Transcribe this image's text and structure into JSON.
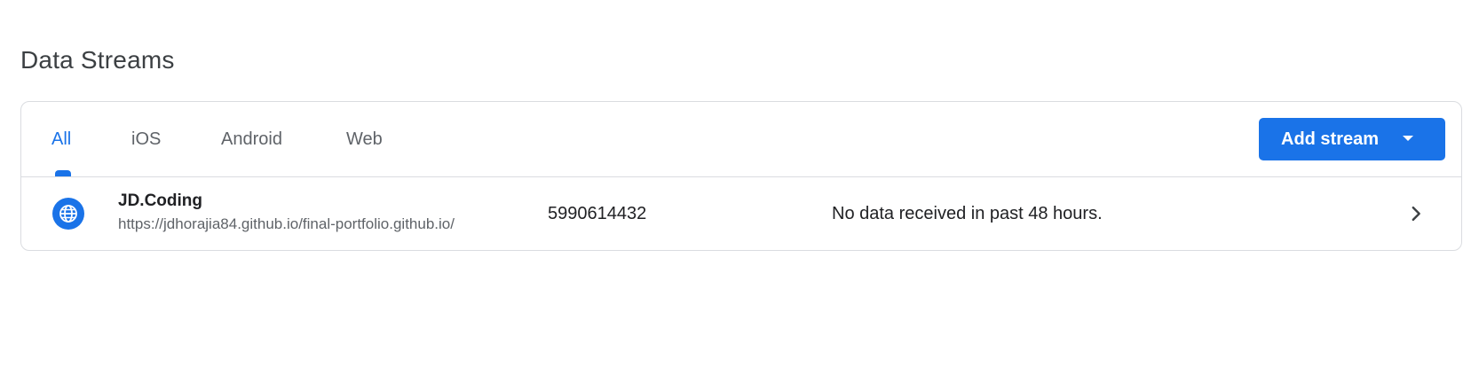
{
  "page": {
    "title": "Data Streams"
  },
  "tabs": [
    {
      "label": "All",
      "active": true
    },
    {
      "label": "iOS",
      "active": false
    },
    {
      "label": "Android",
      "active": false
    },
    {
      "label": "Web",
      "active": false
    }
  ],
  "toolbar": {
    "add_stream_label": "Add stream"
  },
  "streams": [
    {
      "name": "JD.Coding",
      "url": "https://jdhorajia84.github.io/final-portfolio.github.io/",
      "id": "5990614432",
      "status": "No data received in past 48 hours.",
      "icon": "globe-icon"
    }
  ],
  "colors": {
    "accent": "#1a73e8",
    "border": "#dadce0",
    "text_primary": "#202124",
    "text_secondary": "#5f6368"
  }
}
